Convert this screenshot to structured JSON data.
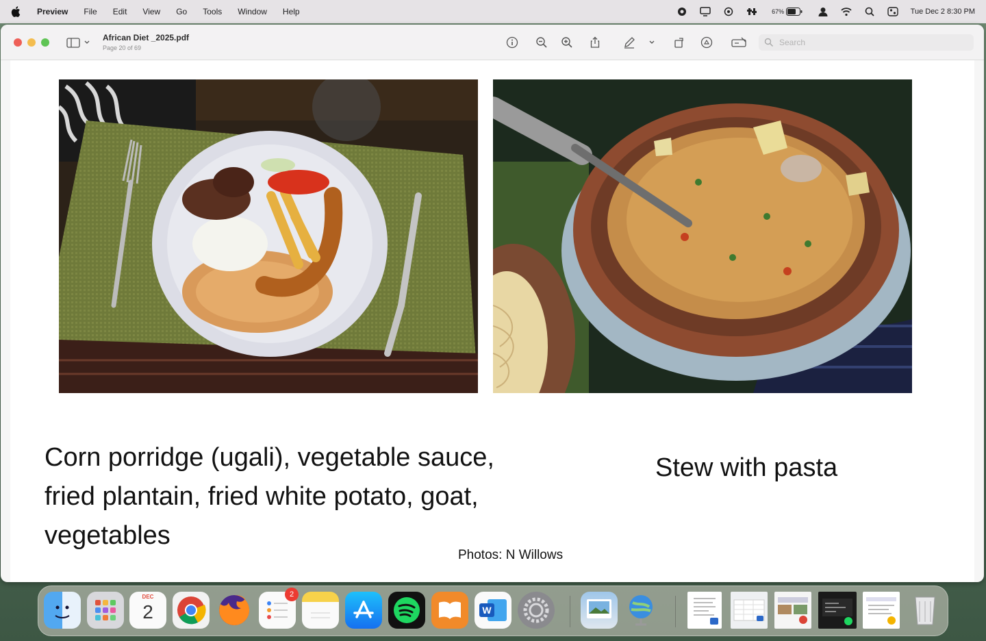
{
  "menubar": {
    "app_name": "Preview",
    "items": [
      "File",
      "Edit",
      "View",
      "Go",
      "Tools",
      "Window",
      "Help"
    ],
    "battery": "67%",
    "clock": "Tue Dec 2  8:30 PM"
  },
  "window": {
    "doc_title": "African Diet _2025.pdf",
    "doc_subtitle": "Page 20 of 69",
    "search_placeholder": "Search"
  },
  "page": {
    "caption_left": "Corn porridge (ugali), vegetable sauce, fried plantain, fried white potato, goat, vegetables",
    "caption_right": "Stew with pasta",
    "credit": "Photos: N Willows"
  },
  "dock": {
    "calendar_month": "DEC",
    "calendar_day": "2",
    "reminders_badge": "2"
  }
}
